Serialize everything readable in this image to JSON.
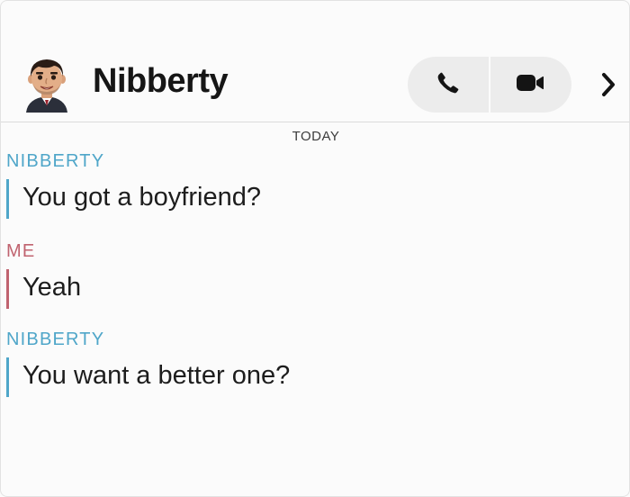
{
  "header": {
    "contact_name": "Nibberty",
    "avatar_icon": "bitmoji-avatar-icon",
    "call_icon": "phone-icon",
    "video_icon": "video-camera-icon",
    "more_icon": "chevron-right-icon"
  },
  "date_separator": "TODAY",
  "colors": {
    "friend": "#4fa6c9",
    "me": "#c0636f"
  },
  "messages": [
    {
      "sender": "NIBBERTY",
      "text": "You got a boyfriend?"
    },
    {
      "sender": "ME",
      "text": "Yeah"
    },
    {
      "sender": "NIBBERTY",
      "text": "You want a better one?"
    }
  ]
}
